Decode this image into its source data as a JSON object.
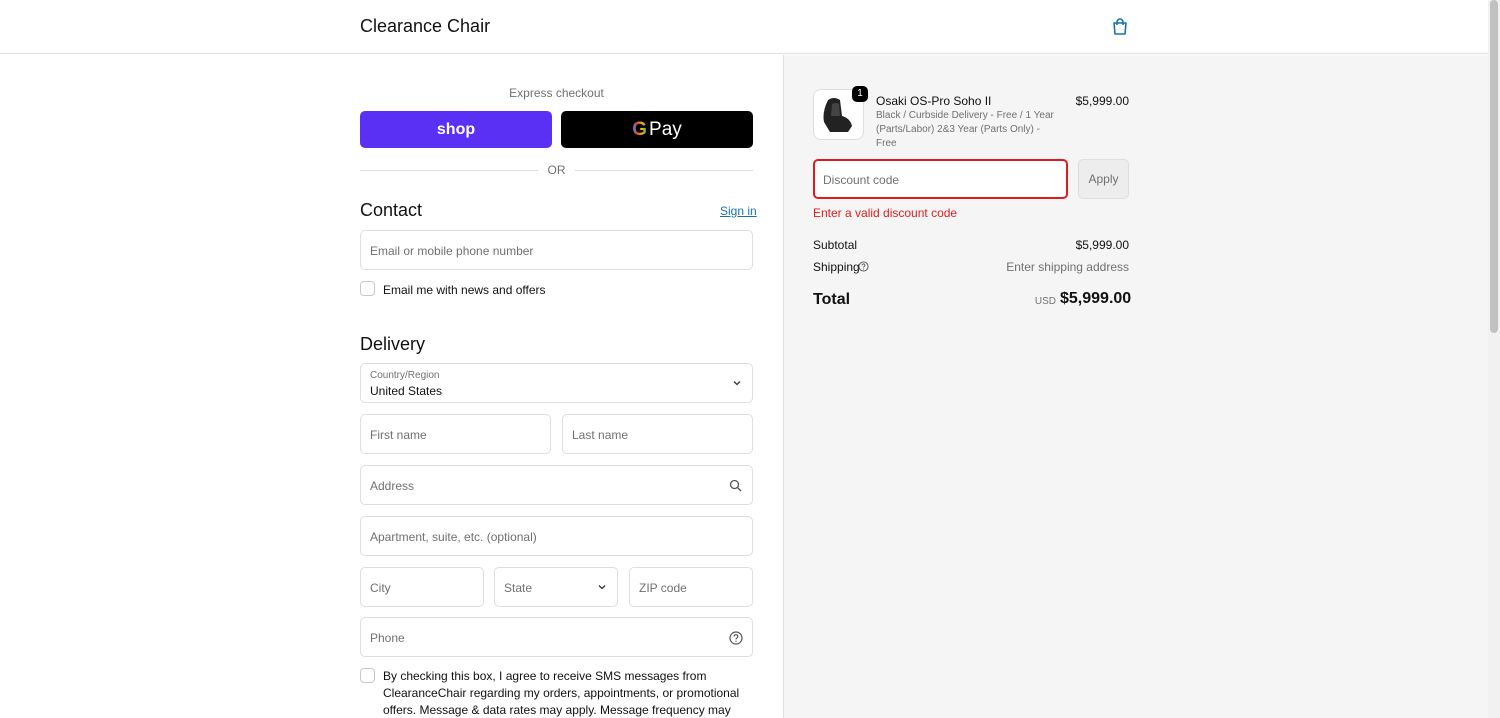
{
  "header": {
    "store_name": "Clearance Chair",
    "cart_icon": "shopping-bag-icon"
  },
  "express": {
    "label": "Express checkout",
    "shop_pay_label": "shop",
    "google_pay_label": "Pay",
    "or_label": "OR"
  },
  "contact": {
    "title": "Contact",
    "signin_label": "Sign in",
    "email_placeholder": "Email or mobile phone number",
    "news_label": "Email me with news and offers"
  },
  "delivery": {
    "title": "Delivery",
    "country_label": "Country/Region",
    "country_value": "United States",
    "first_name_placeholder": "First name",
    "last_name_placeholder": "Last name",
    "address_placeholder": "Address",
    "apartment_placeholder": "Apartment, suite, etc. (optional)",
    "city_placeholder": "City",
    "state_placeholder": "State",
    "zip_placeholder": "ZIP code",
    "phone_placeholder": "Phone",
    "sms_text": "By checking this box, I agree to receive SMS messages from ClearanceChair regarding my orders, appointments, or promotional offers. Message & data rates may apply. Message frequency may vary. Reply HELP for help or STOP"
  },
  "order": {
    "product": {
      "name": "Osaki OS-Pro Soho II",
      "variant": "Black / Curbside Delivery - Free / 1 Year (Parts/Labor) 2&3 Year (Parts Only) - Free",
      "price": "$5,999.00",
      "quantity": "1"
    },
    "discount": {
      "placeholder": "Discount code",
      "apply_label": "Apply",
      "error": "Enter a valid discount code"
    },
    "subtotal_label": "Subtotal",
    "subtotal_value": "$5,999.00",
    "shipping_label": "Shipping",
    "shipping_value": "Enter shipping address",
    "total_label": "Total",
    "total_currency": "USD",
    "total_value": "$5,999.00"
  },
  "colors": {
    "shop_pay": "#5a31f4",
    "error": "#dd1d1d",
    "link": "#1773b0"
  }
}
